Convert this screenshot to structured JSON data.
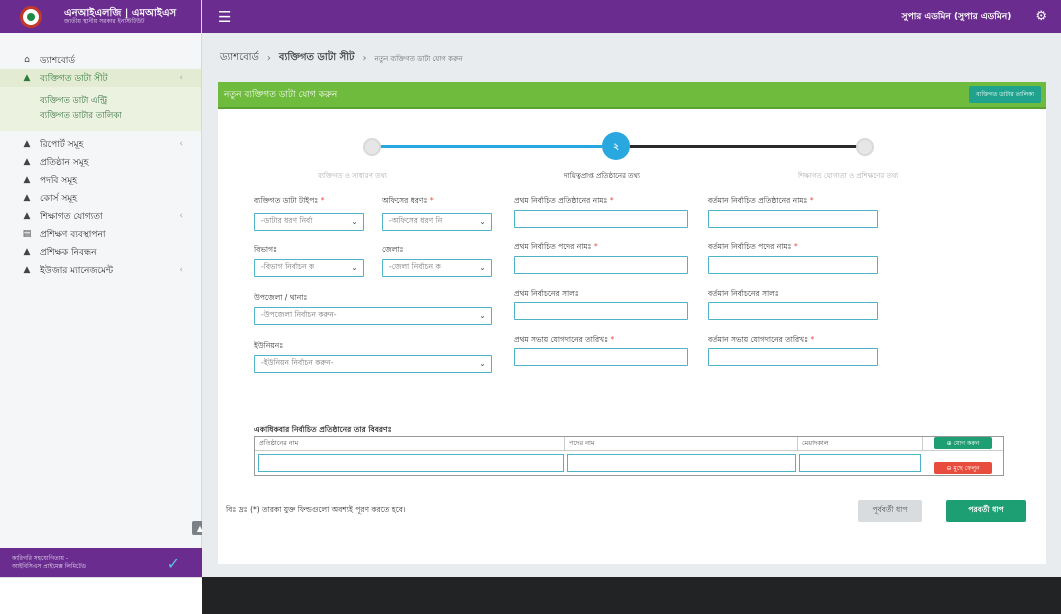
{
  "brand": {
    "title": "এনআইএলজি | এমআইএস",
    "subtitle": "জাতীয় স্থানীয় সরকার ইনস্টিটিউট"
  },
  "topbar": {
    "user": "সুপার এডমিন (সুপার এডমিন)"
  },
  "sidebar": {
    "items": [
      {
        "label": "ড্যাশবোর্ড",
        "icon": "home-icon",
        "arrow": ""
      },
      {
        "label": "ব্যক্তিগত ডাটা সীট",
        "icon": "user-icon",
        "arrow": "‹"
      },
      {
        "label": "রিপোর্ট সমূহ",
        "icon": "user-icon",
        "arrow": "‹"
      },
      {
        "label": "প্রতিষ্ঠান সমূহ",
        "icon": "user-icon",
        "arrow": ""
      },
      {
        "label": "পদবি সমূহ",
        "icon": "user-icon",
        "arrow": ""
      },
      {
        "label": "কোর্স সমূহ",
        "icon": "user-icon",
        "arrow": ""
      },
      {
        "label": "শিক্ষাগত যোগ্যতা",
        "icon": "user-icon",
        "arrow": "‹"
      },
      {
        "label": "প্রশিক্ষণ ব্যবস্থাপনা",
        "icon": "monitor-icon",
        "arrow": ""
      },
      {
        "label": "প্রশিক্ষক নিবন্ধন",
        "icon": "user-icon",
        "arrow": ""
      },
      {
        "label": "ইউজার ম্যানেজমেন্ট",
        "icon": "user-icon",
        "arrow": "‹"
      }
    ],
    "submenu": [
      "ব্যক্তিগত ডাটা এন্ট্রি",
      "ব্যক্তিগত ডাটার তালিকা"
    ],
    "footer_line1": "কারিগরি সহযোগিতায় -",
    "footer_line2": "আইবিসিএস প্রাইমেক্স লিমিটেড"
  },
  "breadcrumb": {
    "home": "ড্যাশবোর্ড",
    "section": "ব্যক্তিগত ডাটা সীট",
    "current": "নতুন ব্যক্তিগত ডাটা যোগ করুন"
  },
  "card": {
    "title": "নতুন ব্যক্তিগত ডাটা যোগ করুন",
    "list_button": "ব্যক্তিগত ডাটার তালিকা"
  },
  "stepper": {
    "steps": [
      {
        "label": "ব্যক্তিগত ও সাধারণ তথ্য",
        "number": ""
      },
      {
        "label": "দায়িত্বপ্রাপ্ত প্রতিষ্ঠানের তথ্য",
        "number": "২"
      },
      {
        "label": "শিক্ষাগত যোগ্যতা ও প্রশিক্ষণের তথ্য",
        "number": ""
      }
    ]
  },
  "form": {
    "data_type_label": "ব্যক্তিগত ডাটা টাইপঃ",
    "data_type_value": "-ডাটার ধরণ নির্বা",
    "office_type_label": "অফিসের ধরণঃ",
    "office_type_value": "-অফিসের ধরণ নি",
    "division_label": "বিভাগঃ",
    "division_value": "-বিভাগ নির্বাচন ক",
    "district_label": "জেলাঃ",
    "district_value": "-জেলা নির্বাচন ক",
    "upazila_label": "উপজেলা / থানাঃ",
    "upazila_value": "-উপজেলা নির্বাচন করুন-",
    "union_label": "ইউনিয়নঃ",
    "union_value": "-ইউনিয়ন নির্বাচন করুন-",
    "first_org_label": "প্রথম নির্বাচিত প্রতিষ্ঠানের নামঃ",
    "first_post_label": "প্রথম নির্বাচিত পদের নামঃ",
    "first_election_label": "প্রথম নির্বাচনের সালঃ",
    "first_join_label": "প্রথম সভায় যোগদানের তারিখঃ",
    "current_org_label": "বর্তমান নির্বাচিত প্রতিষ্ঠানের নামঃ",
    "current_post_label": "বর্তমান নির্বাচিত পদের নামঃ",
    "current_election_label": "বর্তমান নির্বাচনের সালঃ",
    "current_join_label": "বর্তমান সভায় যোগদানের তারিখঃ",
    "required_mark": "*"
  },
  "table": {
    "title": "একাধিকবার নির্বাচিত প্রতিষ্ঠানের তার বিবরণঃ",
    "headers": [
      "প্রতিষ্ঠানের নাম",
      "পদের নাম",
      "মেয়াদকাল"
    ],
    "add_button": "যোগ করুন",
    "remove_button": "মুছে ফেলুন"
  },
  "note": "বিঃ দ্রঃ (*) তারকা যুক্ত ফিল্ডগুলো অবশ্যই পূরণ করতে হবে।",
  "buttons": {
    "previous": "পূর্ববর্তী ধাপ",
    "next": "পরবর্তী ধাপ"
  },
  "colors": {
    "brand": "#6a2d8f",
    "card_header": "#6fbb3d",
    "primary": "#1e9e73",
    "step_active": "#28a8df",
    "danger": "#e74c3c"
  }
}
